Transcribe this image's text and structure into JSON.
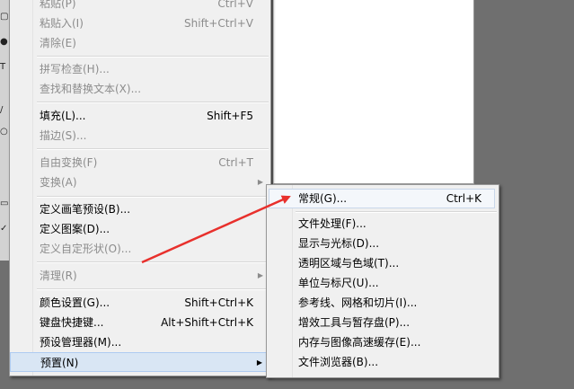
{
  "edit_menu": {
    "items": [
      {
        "label": "粘贴(P)",
        "shortcut": "Ctrl+V",
        "disabled": true
      },
      {
        "label": "粘贴入(I)",
        "shortcut": "Shift+Ctrl+V",
        "disabled": true
      },
      {
        "label": "清除(E)",
        "shortcut": "",
        "disabled": true
      },
      {
        "label": "拼写检查(H)...",
        "shortcut": "",
        "disabled": true
      },
      {
        "label": "查找和替换文本(X)...",
        "shortcut": "",
        "disabled": true
      },
      {
        "label": "填充(L)...",
        "shortcut": "Shift+F5",
        "disabled": false
      },
      {
        "label": "描边(S)...",
        "shortcut": "",
        "disabled": true
      },
      {
        "label": "自由变换(F)",
        "shortcut": "Ctrl+T",
        "disabled": true
      },
      {
        "label": "变换(A)",
        "shortcut": "",
        "disabled": true
      },
      {
        "label": "定义画笔预设(B)...",
        "shortcut": "",
        "disabled": false
      },
      {
        "label": "定义图案(D)...",
        "shortcut": "",
        "disabled": false
      },
      {
        "label": "定义自定形状(O)...",
        "shortcut": "",
        "disabled": true
      },
      {
        "label": "清理(R)",
        "shortcut": "",
        "disabled": true
      },
      {
        "label": "颜色设置(G)...",
        "shortcut": "Shift+Ctrl+K",
        "disabled": false
      },
      {
        "label": "键盘快捷键...",
        "shortcut": "Alt+Shift+Ctrl+K",
        "disabled": false
      },
      {
        "label": "预设管理器(M)...",
        "shortcut": "",
        "disabled": false
      },
      {
        "label": "预置(N)",
        "shortcut": "",
        "disabled": false
      }
    ]
  },
  "preferences_submenu": {
    "items": [
      {
        "label": "常规(G)...",
        "shortcut": "Ctrl+K"
      },
      {
        "label": "文件处理(F)...",
        "shortcut": ""
      },
      {
        "label": "显示与光标(D)...",
        "shortcut": ""
      },
      {
        "label": "透明区域与色域(T)...",
        "shortcut": ""
      },
      {
        "label": "单位与标尺(U)...",
        "shortcut": ""
      },
      {
        "label": "参考线、网格和切片(I)...",
        "shortcut": ""
      },
      {
        "label": "增效工具与暂存盘(P)...",
        "shortcut": ""
      },
      {
        "label": "内存与图像高速缓存(E)...",
        "shortcut": ""
      },
      {
        "label": "文件浏览器(B)...",
        "shortcut": ""
      }
    ]
  },
  "annotation": {
    "color": "#e8302c"
  },
  "toolbox": {
    "icons": [
      "marquee-icon",
      "move-icon",
      "zoom-icon",
      "type-icon",
      "brush-icon",
      "eyedropper-icon",
      "magnifier-icon",
      "hand-icon",
      "check-icon"
    ]
  }
}
